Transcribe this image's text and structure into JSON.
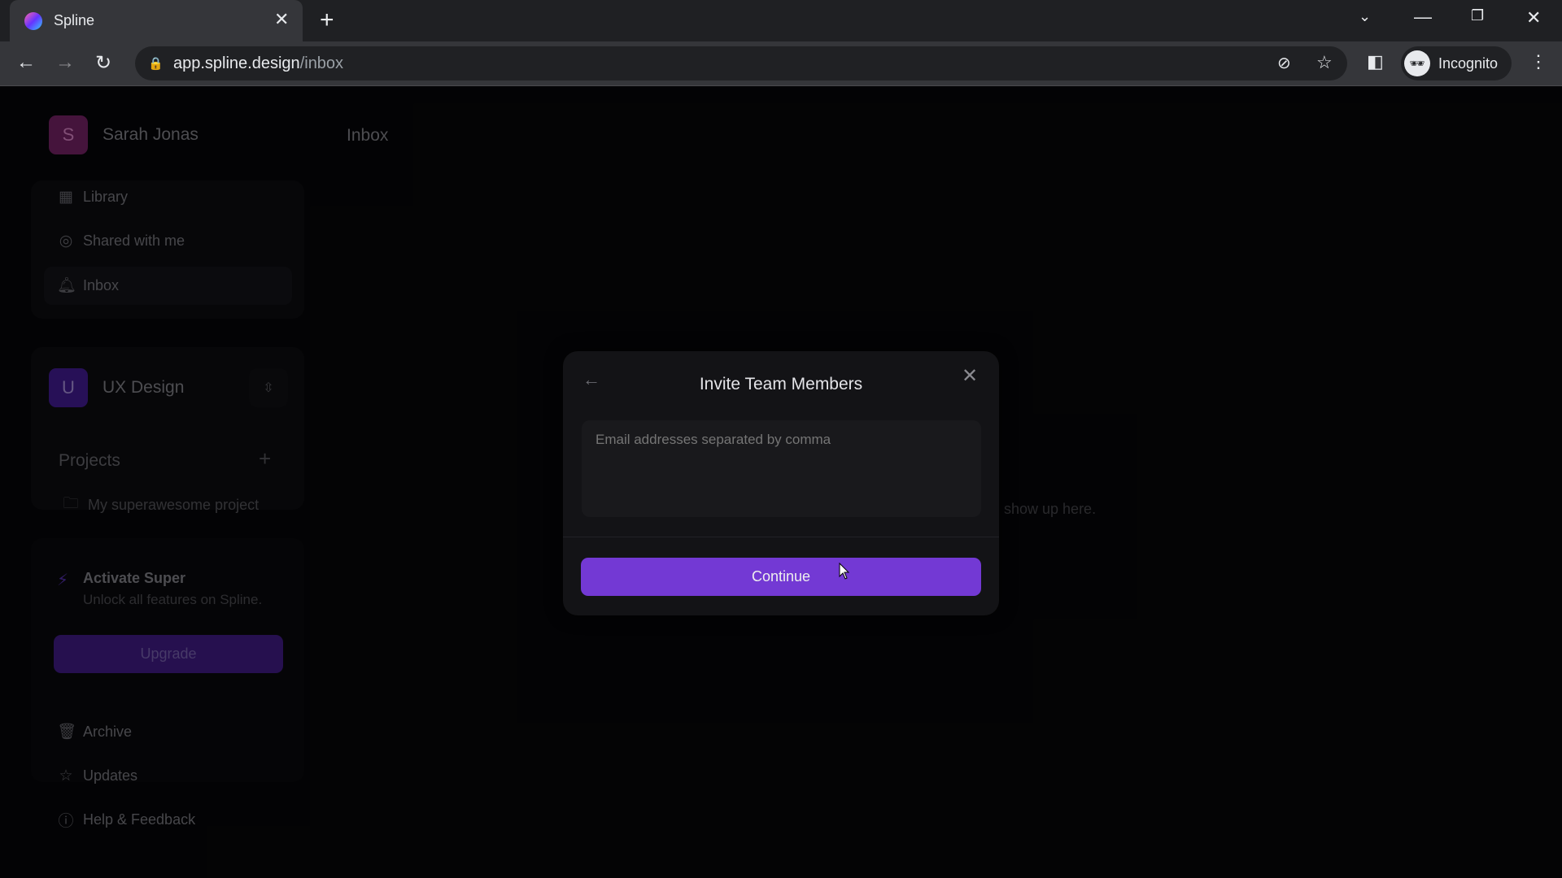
{
  "browser": {
    "tab_title": "Spline",
    "url_domain": "app.spline.design",
    "url_path": "/inbox",
    "profile_label": "Incognito"
  },
  "user": {
    "initial": "S",
    "name": "Sarah Jonas",
    "avatar_color": "#6b1f5c"
  },
  "header": {
    "title": "Inbox"
  },
  "nav": [
    {
      "label": "Library",
      "icon": "library-icon"
    },
    {
      "label": "Shared with me",
      "icon": "user-circle-icon"
    },
    {
      "label": "Inbox",
      "icon": "bell-icon"
    }
  ],
  "team": {
    "initial": "U",
    "name": "UX Design",
    "avatar_color": "#3d1a86"
  },
  "projects": {
    "heading": "Projects",
    "items": [
      "My superawesome project"
    ]
  },
  "promo": {
    "title": "Activate Super",
    "subtitle": "Unlock all features on Spline.",
    "button": "Upgrade",
    "accent": "#3b1a7a"
  },
  "bottom_nav": [
    {
      "label": "Archive",
      "icon": "trash-icon"
    },
    {
      "label": "Updates",
      "icon": "star-icon"
    },
    {
      "label": "Help & Feedback",
      "icon": "help-icon"
    }
  ],
  "empty_text": "show up here.",
  "modal": {
    "title": "Invite Team Members",
    "email_placeholder": "Email addresses separated by comma",
    "continue_label": "Continue",
    "accent": "#7339d4"
  }
}
